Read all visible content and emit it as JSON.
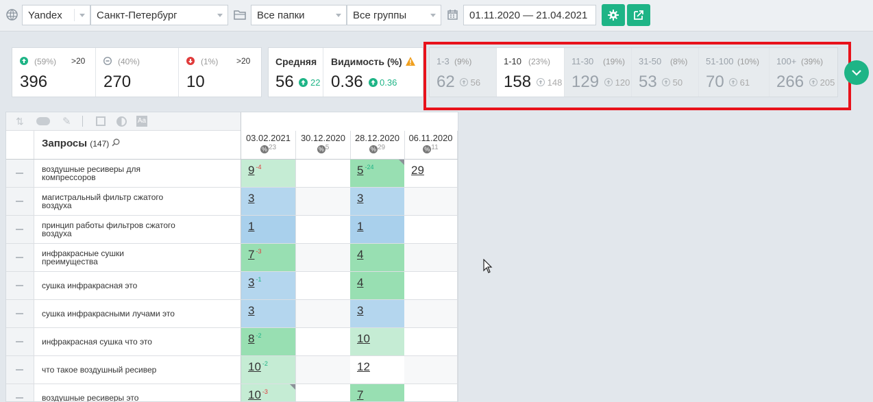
{
  "toolbar": {
    "search_engine": "Yandex",
    "region": "Санкт-Петербург",
    "folders": "Все папки",
    "groups": "Все группы",
    "date_range": "01.11.2020 — 21.04.2021"
  },
  "summary": {
    "up": {
      "pct": "(59%)",
      "tag": ">20",
      "value": "396"
    },
    "same": {
      "pct": "(40%)",
      "value": "270"
    },
    "down": {
      "pct": "(1%)",
      "tag": ">20",
      "value": "10"
    },
    "avg": {
      "label": "Средняя",
      "value": "56",
      "delta": "22"
    },
    "visibility": {
      "label": "Видимость (%)",
      "value": "0.36",
      "delta": "0.36"
    }
  },
  "ranges": [
    {
      "label": "1-3",
      "pct": "(9%)",
      "value": "62",
      "prev": "56",
      "active": false
    },
    {
      "label": "1-10",
      "pct": "(23%)",
      "value": "158",
      "prev": "148",
      "active": true
    },
    {
      "label": "11-30",
      "pct": "(19%)",
      "value": "129",
      "prev": "120",
      "active": false
    },
    {
      "label": "31-50",
      "pct": "(8%)",
      "value": "53",
      "prev": "50",
      "active": false
    },
    {
      "label": "51-100",
      "pct": "(10%)",
      "value": "70",
      "prev": "61",
      "active": false
    },
    {
      "label": "100+",
      "pct": "(39%)",
      "value": "266",
      "prev": "205",
      "active": false
    }
  ],
  "table": {
    "header": {
      "title": "Запросы",
      "count": "(147)"
    },
    "dates": [
      {
        "date": "03.02.2021",
        "count": "23"
      },
      {
        "date": "30.12.2020",
        "count": "5"
      },
      {
        "date": "28.12.2020",
        "count": "29"
      },
      {
        "date": "06.11.2020",
        "count": "11"
      }
    ],
    "rows": [
      {
        "query": "воздушные ресиверы для компрессоров",
        "cells": [
          {
            "v": "9",
            "d": "-4",
            "dc": "red",
            "bg": "c-lgreen"
          },
          {
            "v": "",
            "bg": "c-white"
          },
          {
            "v": "5",
            "d": "-24",
            "dc": "green",
            "bg": "c-green",
            "corner": true
          },
          {
            "v": "29",
            "bg": "c-white"
          }
        ]
      },
      {
        "query": "магистральный фильтр сжатого воздуха",
        "cells": [
          {
            "v": "3",
            "bg": "c-blue"
          },
          {
            "v": "",
            "bg": "c-white"
          },
          {
            "v": "3",
            "bg": "c-blue"
          },
          {
            "v": "",
            "bg": "c-white"
          }
        ]
      },
      {
        "query": "принцип работы фильтров сжатого воздуха",
        "cells": [
          {
            "v": "1",
            "bg": "c-blue2"
          },
          {
            "v": "",
            "bg": "c-white"
          },
          {
            "v": "1",
            "bg": "c-blue2"
          },
          {
            "v": "",
            "bg": "c-white"
          }
        ]
      },
      {
        "query": "инфракрасные сушки преимущества",
        "cells": [
          {
            "v": "7",
            "d": "-3",
            "dc": "red",
            "bg": "c-green"
          },
          {
            "v": "",
            "bg": "c-white"
          },
          {
            "v": "4",
            "bg": "c-green"
          },
          {
            "v": "",
            "bg": "c-white"
          }
        ]
      },
      {
        "query": "сушка инфракрасная это",
        "cells": [
          {
            "v": "3",
            "d": "-1",
            "dc": "green",
            "bg": "c-blue"
          },
          {
            "v": "",
            "bg": "c-white"
          },
          {
            "v": "4",
            "bg": "c-green"
          },
          {
            "v": "",
            "bg": "c-white"
          }
        ]
      },
      {
        "query": "сушка инфракрасными лучами это",
        "cells": [
          {
            "v": "3",
            "bg": "c-blue"
          },
          {
            "v": "",
            "bg": "c-white"
          },
          {
            "v": "3",
            "bg": "c-blue"
          },
          {
            "v": "",
            "bg": "c-white"
          }
        ]
      },
      {
        "query": "инфракрасная сушка что это",
        "cells": [
          {
            "v": "8",
            "d": "-2",
            "dc": "green",
            "bg": "c-green"
          },
          {
            "v": "",
            "bg": "c-white"
          },
          {
            "v": "10",
            "bg": "c-lgreen"
          },
          {
            "v": "",
            "bg": "c-white"
          }
        ]
      },
      {
        "query": "что такое воздушный ресивер",
        "cells": [
          {
            "v": "10",
            "d": "-2",
            "dc": "green",
            "bg": "c-lgreen"
          },
          {
            "v": "",
            "bg": "c-white"
          },
          {
            "v": "12",
            "bg": "c-white"
          },
          {
            "v": "",
            "bg": "c-white"
          }
        ]
      },
      {
        "query": "воздушные ресиверы это",
        "cells": [
          {
            "v": "10",
            "d": "-3",
            "dc": "red",
            "bg": "c-lgreen",
            "corner": true
          },
          {
            "v": "",
            "bg": "c-white"
          },
          {
            "v": "7",
            "bg": "c-green"
          },
          {
            "v": "",
            "bg": "c-white"
          }
        ]
      }
    ]
  },
  "colors": {
    "accent": "#1eb486",
    "highlight": "#e8121b",
    "down": "#e03b3b"
  },
  "icons": [
    "globe-icon",
    "folder-icon",
    "calendar-icon",
    "gear-icon",
    "export-icon",
    "arrow-up-circle-icon",
    "equal-circle-icon",
    "arrow-down-circle-icon",
    "warning-icon",
    "chevron-down-icon",
    "search-icon",
    "percent-icon"
  ]
}
